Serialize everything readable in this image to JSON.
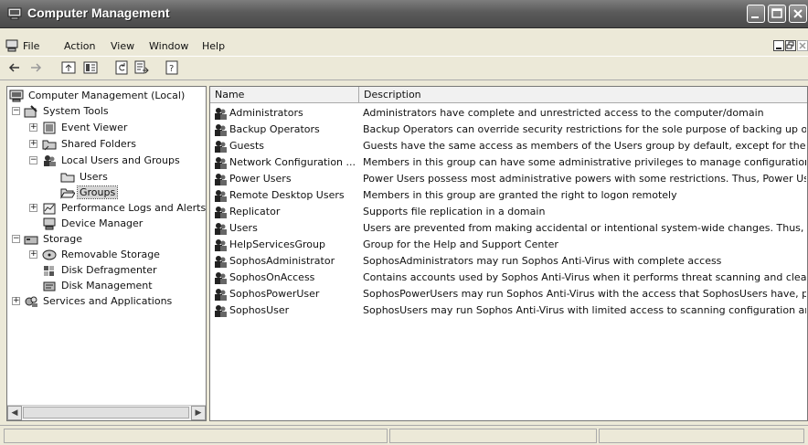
{
  "window": {
    "title": "Computer Management"
  },
  "menu": {
    "items": [
      "File",
      "Action",
      "View",
      "Window",
      "Help"
    ]
  },
  "toolbar": {
    "icons": [
      "back-icon",
      "forward-icon",
      "up-icon",
      "show-hide-tree-icon",
      "refresh-icon",
      "export-list-icon",
      "help-icon"
    ]
  },
  "tree": {
    "items": [
      {
        "label": "Computer Management (Local)",
        "icon": "computer-icon"
      },
      {
        "label": "System Tools",
        "icon": "tools-icon"
      },
      {
        "label": "Event Viewer",
        "icon": "event-viewer-icon"
      },
      {
        "label": "Shared Folders",
        "icon": "shared-folder-icon"
      },
      {
        "label": "Local Users and Groups",
        "icon": "users-groups-icon"
      },
      {
        "label": "Users",
        "icon": "folder-icon"
      },
      {
        "label": "Groups",
        "icon": "folder-open-icon"
      },
      {
        "label": "Performance Logs and Alerts",
        "icon": "performance-icon"
      },
      {
        "label": "Device Manager",
        "icon": "device-manager-icon"
      },
      {
        "label": "Storage",
        "icon": "storage-icon"
      },
      {
        "label": "Removable Storage",
        "icon": "removable-storage-icon"
      },
      {
        "label": "Disk Defragmenter",
        "icon": "defrag-icon"
      },
      {
        "label": "Disk Management",
        "icon": "disk-management-icon"
      },
      {
        "label": "Services and Applications",
        "icon": "services-icon"
      }
    ]
  },
  "list": {
    "columns": [
      "Name",
      "Description"
    ],
    "rows": [
      {
        "name": "Administrators",
        "description": "Administrators have complete and unrestricted access to the computer/domain"
      },
      {
        "name": "Backup Operators",
        "description": "Backup Operators can override security restrictions for the sole purpose of backing up or r..."
      },
      {
        "name": "Guests",
        "description": "Guests have the same access as members of the Users group by default, except for the G..."
      },
      {
        "name": "Network Configuration ...",
        "description": "Members in this group can have some administrative privileges to manage configuration of ..."
      },
      {
        "name": "Power Users",
        "description": "Power Users possess most administrative powers with some restrictions. Thus, Power User..."
      },
      {
        "name": "Remote Desktop Users",
        "description": "Members in this group are granted the right to logon remotely"
      },
      {
        "name": "Replicator",
        "description": "Supports file replication in a domain"
      },
      {
        "name": "Users",
        "description": "Users are prevented from making accidental or intentional system-wide changes. Thus, Us..."
      },
      {
        "name": "HelpServicesGroup",
        "description": "Group for the Help and Support Center"
      },
      {
        "name": "SophosAdministrator",
        "description": "SophosAdministrators may run Sophos Anti-Virus with complete access"
      },
      {
        "name": "SophosOnAccess",
        "description": "Contains accounts used by Sophos Anti-Virus when it performs threat scanning and cleanu..."
      },
      {
        "name": "SophosPowerUser",
        "description": "SophosPowerUsers may run Sophos Anti-Virus with the access that SophosUsers have, plu..."
      },
      {
        "name": "SophosUser",
        "description": "SophosUsers may run Sophos Anti-Virus with limited access to scanning configuration and cl..."
      }
    ]
  }
}
